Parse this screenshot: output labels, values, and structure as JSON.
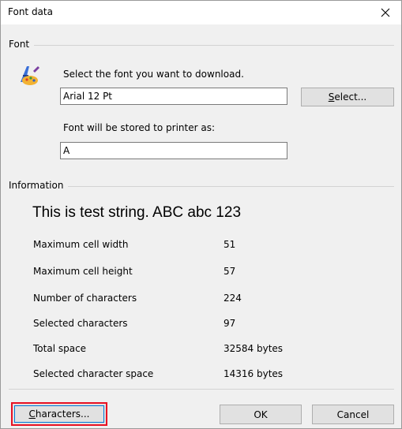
{
  "window": {
    "title": "Font data"
  },
  "font_group": {
    "label": "Font",
    "select_prompt": "Select the font you want to download.",
    "font_value": "Arial 12 Pt",
    "select_button": {
      "label_underlined": "S",
      "label_rest": "elect..."
    },
    "stored_prompt": "Font will be stored to printer as:",
    "stored_value": "A"
  },
  "info_group": {
    "label": "Information",
    "test_string": "This is test string. ABC abc 123",
    "rows": [
      {
        "label": "Maximum cell width",
        "value": "51"
      },
      {
        "label": "Maximum cell height",
        "value": "57"
      },
      {
        "label": "Number of characters",
        "value": "224"
      },
      {
        "label": "Selected characters",
        "value": "97"
      },
      {
        "label": "Total space",
        "value": "32584 bytes"
      },
      {
        "label": "Selected character space",
        "value": "14316 bytes"
      }
    ]
  },
  "buttons": {
    "characters": {
      "label_underlined": "C",
      "label_rest": "haracters..."
    },
    "ok": "OK",
    "cancel": "Cancel"
  },
  "colors": {
    "focus_outline": "#e81123",
    "focus_inner": "#0078d7"
  },
  "icons": {
    "close": "close-icon",
    "font_tool": "font-tool-icon"
  }
}
